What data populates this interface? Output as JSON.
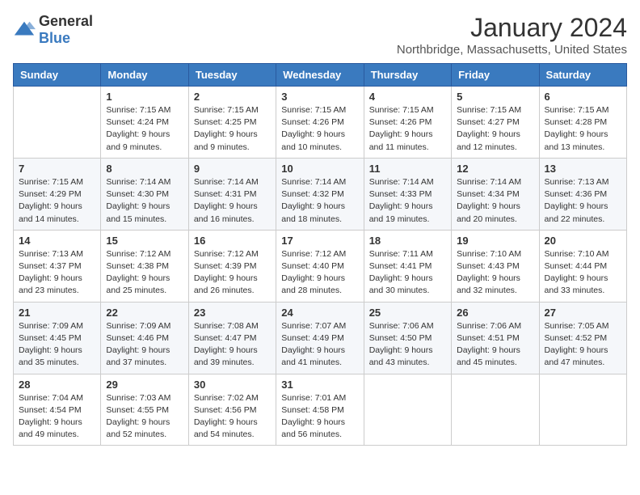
{
  "logo": {
    "general": "General",
    "blue": "Blue"
  },
  "header": {
    "title": "January 2024",
    "subtitle": "Northbridge, Massachusetts, United States"
  },
  "days": [
    "Sunday",
    "Monday",
    "Tuesday",
    "Wednesday",
    "Thursday",
    "Friday",
    "Saturday"
  ],
  "weeks": [
    [
      {
        "num": "",
        "sunrise": "",
        "sunset": "",
        "daylight": ""
      },
      {
        "num": "1",
        "sunrise": "Sunrise: 7:15 AM",
        "sunset": "Sunset: 4:24 PM",
        "daylight": "Daylight: 9 hours and 9 minutes."
      },
      {
        "num": "2",
        "sunrise": "Sunrise: 7:15 AM",
        "sunset": "Sunset: 4:25 PM",
        "daylight": "Daylight: 9 hours and 9 minutes."
      },
      {
        "num": "3",
        "sunrise": "Sunrise: 7:15 AM",
        "sunset": "Sunset: 4:26 PM",
        "daylight": "Daylight: 9 hours and 10 minutes."
      },
      {
        "num": "4",
        "sunrise": "Sunrise: 7:15 AM",
        "sunset": "Sunset: 4:26 PM",
        "daylight": "Daylight: 9 hours and 11 minutes."
      },
      {
        "num": "5",
        "sunrise": "Sunrise: 7:15 AM",
        "sunset": "Sunset: 4:27 PM",
        "daylight": "Daylight: 9 hours and 12 minutes."
      },
      {
        "num": "6",
        "sunrise": "Sunrise: 7:15 AM",
        "sunset": "Sunset: 4:28 PM",
        "daylight": "Daylight: 9 hours and 13 minutes."
      }
    ],
    [
      {
        "num": "7",
        "sunrise": "Sunrise: 7:15 AM",
        "sunset": "Sunset: 4:29 PM",
        "daylight": "Daylight: 9 hours and 14 minutes."
      },
      {
        "num": "8",
        "sunrise": "Sunrise: 7:14 AM",
        "sunset": "Sunset: 4:30 PM",
        "daylight": "Daylight: 9 hours and 15 minutes."
      },
      {
        "num": "9",
        "sunrise": "Sunrise: 7:14 AM",
        "sunset": "Sunset: 4:31 PM",
        "daylight": "Daylight: 9 hours and 16 minutes."
      },
      {
        "num": "10",
        "sunrise": "Sunrise: 7:14 AM",
        "sunset": "Sunset: 4:32 PM",
        "daylight": "Daylight: 9 hours and 18 minutes."
      },
      {
        "num": "11",
        "sunrise": "Sunrise: 7:14 AM",
        "sunset": "Sunset: 4:33 PM",
        "daylight": "Daylight: 9 hours and 19 minutes."
      },
      {
        "num": "12",
        "sunrise": "Sunrise: 7:14 AM",
        "sunset": "Sunset: 4:34 PM",
        "daylight": "Daylight: 9 hours and 20 minutes."
      },
      {
        "num": "13",
        "sunrise": "Sunrise: 7:13 AM",
        "sunset": "Sunset: 4:36 PM",
        "daylight": "Daylight: 9 hours and 22 minutes."
      }
    ],
    [
      {
        "num": "14",
        "sunrise": "Sunrise: 7:13 AM",
        "sunset": "Sunset: 4:37 PM",
        "daylight": "Daylight: 9 hours and 23 minutes."
      },
      {
        "num": "15",
        "sunrise": "Sunrise: 7:12 AM",
        "sunset": "Sunset: 4:38 PM",
        "daylight": "Daylight: 9 hours and 25 minutes."
      },
      {
        "num": "16",
        "sunrise": "Sunrise: 7:12 AM",
        "sunset": "Sunset: 4:39 PM",
        "daylight": "Daylight: 9 hours and 26 minutes."
      },
      {
        "num": "17",
        "sunrise": "Sunrise: 7:12 AM",
        "sunset": "Sunset: 4:40 PM",
        "daylight": "Daylight: 9 hours and 28 minutes."
      },
      {
        "num": "18",
        "sunrise": "Sunrise: 7:11 AM",
        "sunset": "Sunset: 4:41 PM",
        "daylight": "Daylight: 9 hours and 30 minutes."
      },
      {
        "num": "19",
        "sunrise": "Sunrise: 7:10 AM",
        "sunset": "Sunset: 4:43 PM",
        "daylight": "Daylight: 9 hours and 32 minutes."
      },
      {
        "num": "20",
        "sunrise": "Sunrise: 7:10 AM",
        "sunset": "Sunset: 4:44 PM",
        "daylight": "Daylight: 9 hours and 33 minutes."
      }
    ],
    [
      {
        "num": "21",
        "sunrise": "Sunrise: 7:09 AM",
        "sunset": "Sunset: 4:45 PM",
        "daylight": "Daylight: 9 hours and 35 minutes."
      },
      {
        "num": "22",
        "sunrise": "Sunrise: 7:09 AM",
        "sunset": "Sunset: 4:46 PM",
        "daylight": "Daylight: 9 hours and 37 minutes."
      },
      {
        "num": "23",
        "sunrise": "Sunrise: 7:08 AM",
        "sunset": "Sunset: 4:47 PM",
        "daylight": "Daylight: 9 hours and 39 minutes."
      },
      {
        "num": "24",
        "sunrise": "Sunrise: 7:07 AM",
        "sunset": "Sunset: 4:49 PM",
        "daylight": "Daylight: 9 hours and 41 minutes."
      },
      {
        "num": "25",
        "sunrise": "Sunrise: 7:06 AM",
        "sunset": "Sunset: 4:50 PM",
        "daylight": "Daylight: 9 hours and 43 minutes."
      },
      {
        "num": "26",
        "sunrise": "Sunrise: 7:06 AM",
        "sunset": "Sunset: 4:51 PM",
        "daylight": "Daylight: 9 hours and 45 minutes."
      },
      {
        "num": "27",
        "sunrise": "Sunrise: 7:05 AM",
        "sunset": "Sunset: 4:52 PM",
        "daylight": "Daylight: 9 hours and 47 minutes."
      }
    ],
    [
      {
        "num": "28",
        "sunrise": "Sunrise: 7:04 AM",
        "sunset": "Sunset: 4:54 PM",
        "daylight": "Daylight: 9 hours and 49 minutes."
      },
      {
        "num": "29",
        "sunrise": "Sunrise: 7:03 AM",
        "sunset": "Sunset: 4:55 PM",
        "daylight": "Daylight: 9 hours and 52 minutes."
      },
      {
        "num": "30",
        "sunrise": "Sunrise: 7:02 AM",
        "sunset": "Sunset: 4:56 PM",
        "daylight": "Daylight: 9 hours and 54 minutes."
      },
      {
        "num": "31",
        "sunrise": "Sunrise: 7:01 AM",
        "sunset": "Sunset: 4:58 PM",
        "daylight": "Daylight: 9 hours and 56 minutes."
      },
      {
        "num": "",
        "sunrise": "",
        "sunset": "",
        "daylight": ""
      },
      {
        "num": "",
        "sunrise": "",
        "sunset": "",
        "daylight": ""
      },
      {
        "num": "",
        "sunrise": "",
        "sunset": "",
        "daylight": ""
      }
    ]
  ]
}
